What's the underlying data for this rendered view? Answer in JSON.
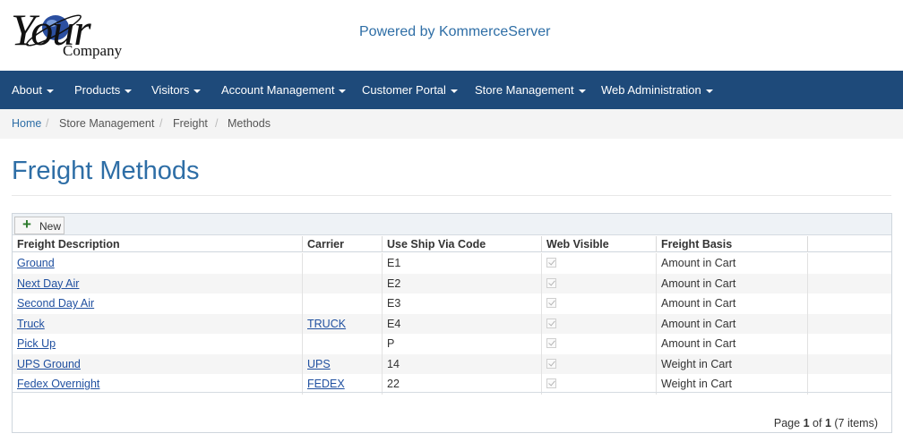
{
  "brand": {
    "logo_word": "Your",
    "logo_company": "Company",
    "powered_by": "Powered by KommerceServer"
  },
  "nav": {
    "items": [
      {
        "label": "About"
      },
      {
        "label": "Products"
      },
      {
        "label": "Visitors"
      },
      {
        "label": "Account Management"
      },
      {
        "label": "Customer Portal"
      },
      {
        "label": "Store Management"
      },
      {
        "label": "Web Administration"
      }
    ]
  },
  "breadcrumb": [
    "Home",
    "Store Management",
    "Freight",
    "Methods"
  ],
  "page": {
    "title": "Freight Methods"
  },
  "toolbar": {
    "new_label": "New"
  },
  "table": {
    "columns": [
      "Freight Description",
      "Carrier",
      "Use Ship Via Code",
      "Web Visible",
      "Freight Basis"
    ],
    "rows": [
      {
        "description": "Ground",
        "carrier": "",
        "ship_via": "E1",
        "web_visible": true,
        "basis": "Amount in Cart"
      },
      {
        "description": "Next Day Air",
        "carrier": "",
        "ship_via": "E2",
        "web_visible": true,
        "basis": "Amount in Cart"
      },
      {
        "description": "Second Day Air",
        "carrier": "",
        "ship_via": "E3",
        "web_visible": true,
        "basis": "Amount in Cart"
      },
      {
        "description": "Truck",
        "carrier": "TRUCK",
        "ship_via": "E4",
        "web_visible": true,
        "basis": "Amount in Cart"
      },
      {
        "description": "Pick Up",
        "carrier": "",
        "ship_via": "P",
        "web_visible": true,
        "basis": "Amount in Cart"
      },
      {
        "description": "UPS Ground",
        "carrier": "UPS",
        "ship_via": "14",
        "web_visible": true,
        "basis": "Weight in Cart"
      },
      {
        "description": "Fedex Overnight",
        "carrier": "FEDEX",
        "ship_via": "22",
        "web_visible": true,
        "basis": "Weight in Cart"
      }
    ]
  },
  "pager": {
    "prefix": "Page",
    "current": "1",
    "of": "of",
    "total": "1",
    "items": "(7 items)"
  },
  "colors": {
    "navbar": "#1e4a7a",
    "link": "#2e6ea6",
    "title": "#2e6ea6"
  }
}
